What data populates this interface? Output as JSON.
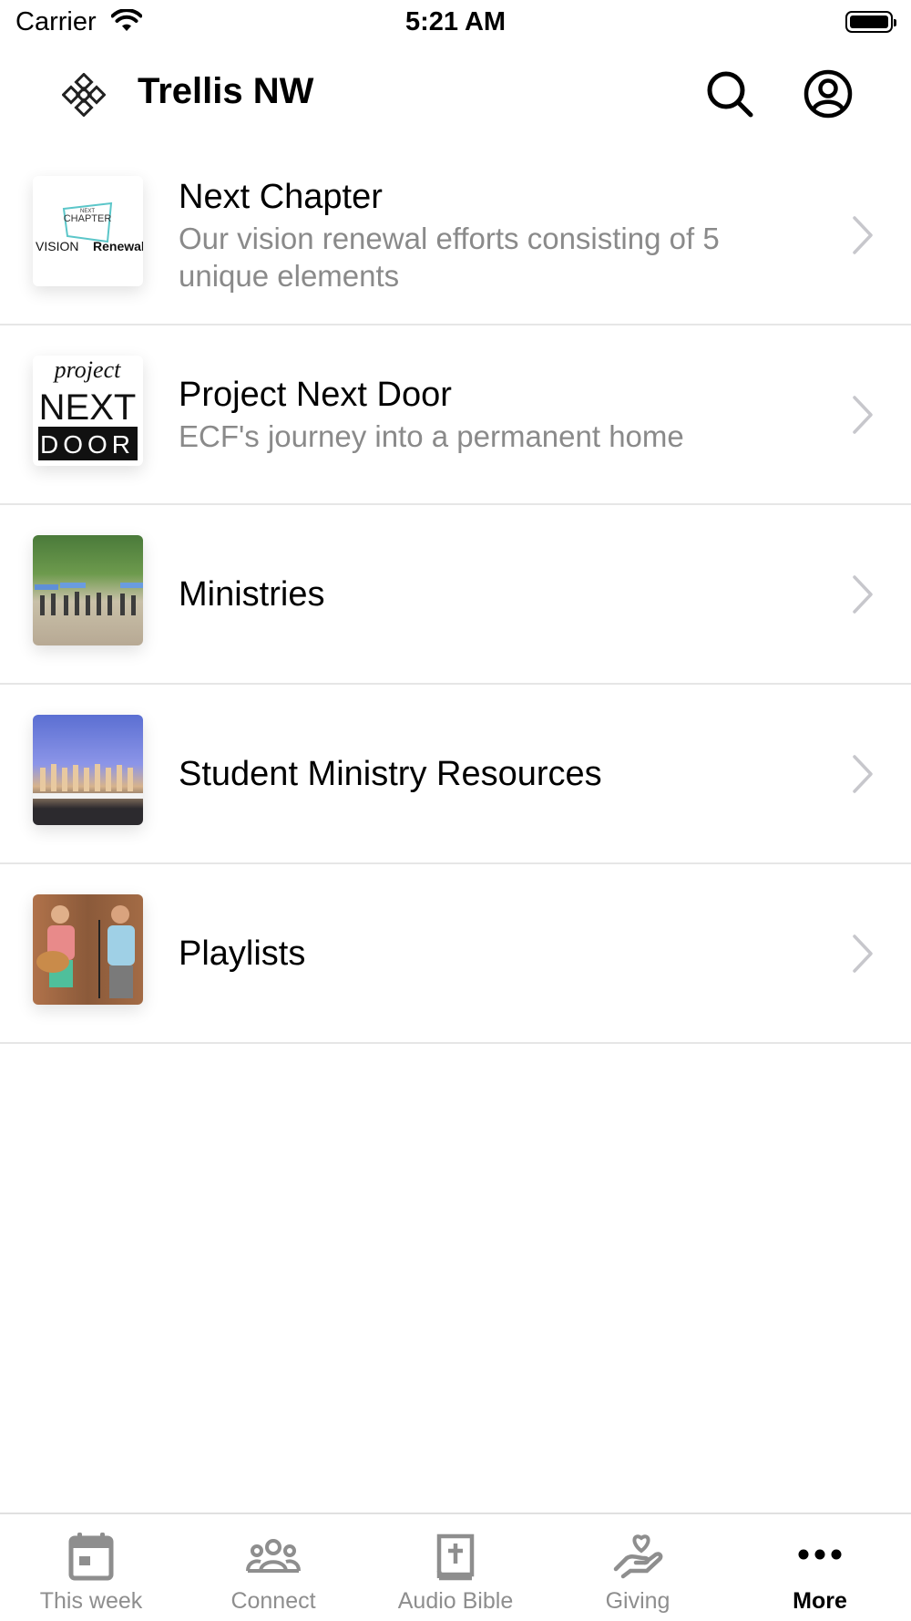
{
  "status_bar": {
    "carrier": "Carrier",
    "time": "5:21 AM"
  },
  "header": {
    "title": "Trellis NW"
  },
  "list": [
    {
      "title": "Next Chapter",
      "subtitle": "Our vision renewal efforts consisting of 5 unique elements",
      "thumb_text": [
        "NEXT",
        "CHAPTER",
        "VISION",
        "Renewal"
      ]
    },
    {
      "title": "Project Next Door",
      "subtitle": "ECF's journey into a permanent home",
      "thumb_text": [
        "project",
        "NEXT",
        "DOOR"
      ]
    },
    {
      "title": "Ministries",
      "subtitle": ""
    },
    {
      "title": "Student Ministry Resources",
      "subtitle": ""
    },
    {
      "title": "Playlists",
      "subtitle": ""
    }
  ],
  "tabs": [
    {
      "label": "This week",
      "icon": "calendar-icon"
    },
    {
      "label": "Connect",
      "icon": "people-icon"
    },
    {
      "label": "Audio Bible",
      "icon": "bible-icon"
    },
    {
      "label": "Giving",
      "icon": "giving-hand-icon"
    },
    {
      "label": "More",
      "icon": "more-icon",
      "active": true
    }
  ],
  "colors": {
    "accent": "#000000",
    "inactive_tab": "#8e8e8e",
    "subtitle": "#8a8a8a",
    "divider": "#e6e6e6",
    "thumb_teal": "#5bc6c9"
  }
}
